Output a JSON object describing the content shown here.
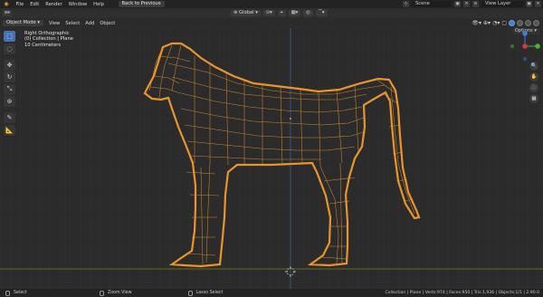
{
  "topbar": {
    "menus": [
      "File",
      "Edit",
      "Render",
      "Window",
      "Help"
    ],
    "back_button": "Back to Previous",
    "scene": "Scene",
    "view_layer": "View Layer"
  },
  "header": {
    "orientation": "Global",
    "mode": "Object Mode",
    "menus": [
      "View",
      "Select",
      "Add",
      "Object"
    ],
    "options": "Options"
  },
  "viewport": {
    "overlay": [
      "Right Orthographic",
      "(0) Collection | Plane",
      "10 Centimeters"
    ],
    "accent_color": "#e8952c",
    "grid_color": "#333333"
  },
  "statusbar": {
    "left": "Select",
    "middle": "Zoom View",
    "right": "Lasso Select",
    "stats": "Collection | Plane | Verts:974 | Faces:950 | Tris:1,936 | Objects:1/1 | 2.90.0"
  }
}
